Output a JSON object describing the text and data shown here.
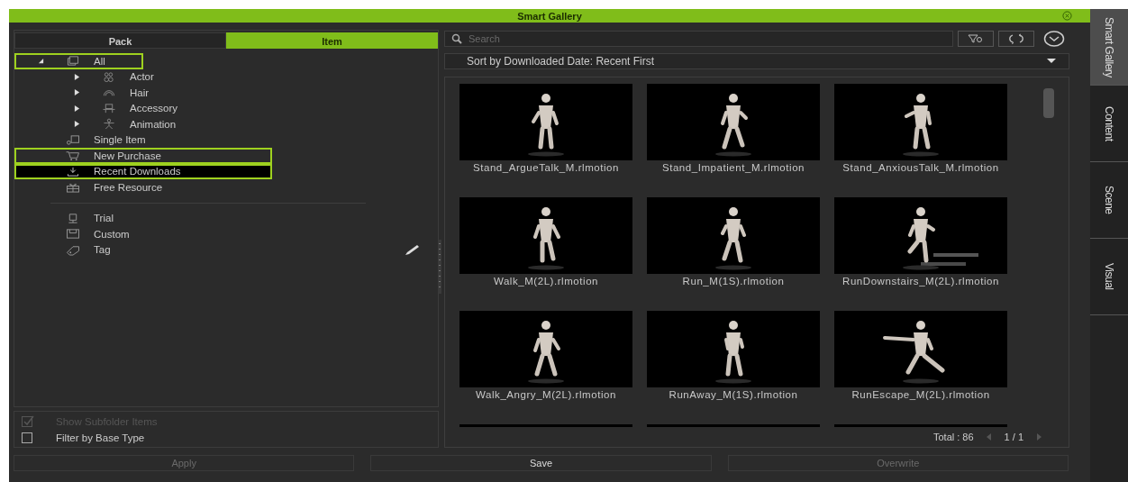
{
  "window": {
    "title": "Smart Gallery"
  },
  "side_tabs": [
    {
      "label": "Smart Gallery",
      "selected": true
    },
    {
      "label": "Content",
      "selected": false
    },
    {
      "label": "Scene",
      "selected": false
    },
    {
      "label": "Visual",
      "selected": false
    }
  ],
  "left_tabs": [
    {
      "label": "Pack",
      "selected": false
    },
    {
      "label": "Item",
      "selected": true
    }
  ],
  "tree_sections": [
    [
      {
        "label": "All",
        "expanded": true,
        "highlighted": true,
        "selected": false,
        "children": [
          {
            "label": "Actor",
            "expanded": false,
            "highlighted": false,
            "selected": false
          },
          {
            "label": "Hair",
            "expanded": false,
            "highlighted": false,
            "selected": false
          },
          {
            "label": "Accessory",
            "expanded": false,
            "highlighted": false,
            "selected": false
          },
          {
            "label": "Animation",
            "expanded": false,
            "highlighted": false,
            "selected": false
          }
        ]
      },
      {
        "label": "Single Item",
        "highlighted": false,
        "selected": false
      },
      {
        "label": "New Purchase",
        "highlighted": true,
        "selected": false
      },
      {
        "label": "Recent Downloads",
        "highlighted": true,
        "selected": true
      },
      {
        "label": "Free Resource",
        "highlighted": false,
        "selected": false
      }
    ],
    [
      {
        "label": "Trial",
        "highlighted": false,
        "selected": false
      },
      {
        "label": "Custom",
        "highlighted": false,
        "selected": false
      },
      {
        "label": "Tag",
        "highlighted": false,
        "selected": false,
        "editable": true
      }
    ]
  ],
  "options": [
    {
      "label": "Show Subfolder Items",
      "checked": true,
      "disabled": true
    },
    {
      "label": "Filter by Base Type",
      "checked": false,
      "disabled": false
    }
  ],
  "search": {
    "placeholder": "Search"
  },
  "sort": {
    "value": "Sort by Downloaded Date: Recent First"
  },
  "thumbnails": [
    {
      "kind": "picture",
      "caption": "Stand_ArgueTalk_M.rlmotion"
    },
    {
      "kind": "picture",
      "caption": "Stand_Impatient_M.rlmotion"
    },
    {
      "kind": "picture",
      "caption": "Stand_AnxiousTalk_M.rlmotion"
    },
    {
      "kind": "picture",
      "caption": "Walk_M(2L).rlmotion"
    },
    {
      "kind": "picture",
      "caption": "Run_M(1S).rlmotion"
    },
    {
      "kind": "picture",
      "caption": "RunDownstairs_M(2L).rlmotion"
    },
    {
      "kind": "picture",
      "caption": "Walk_Angry_M(2L).rlmotion"
    },
    {
      "kind": "picture",
      "caption": "RunAway_M(1S).rlmotion"
    },
    {
      "kind": "picture",
      "caption": "RunEscape_M(2L).rlmotion"
    },
    {
      "kind": "picture"
    },
    {
      "kind": "picture"
    },
    {
      "kind": "picture"
    }
  ],
  "footer": {
    "total": "Total : 86",
    "page": "1 / 1"
  },
  "buttons": [
    {
      "label": "Apply",
      "disabled": true
    },
    {
      "label": "Save",
      "disabled": false
    },
    {
      "label": "Overwrite",
      "disabled": true
    }
  ]
}
